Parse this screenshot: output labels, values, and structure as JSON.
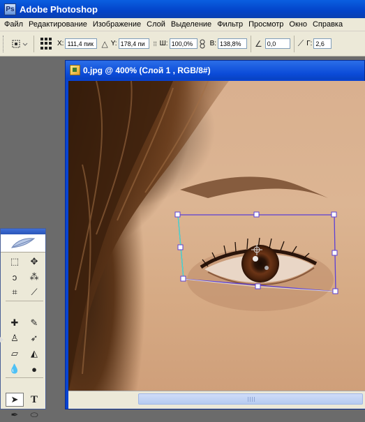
{
  "app": {
    "title": "Adobe Photoshop",
    "logo_text": "Ps"
  },
  "menu": [
    "Файл",
    "Редактирование",
    "Изображение",
    "Слой",
    "Выделение",
    "Фильтр",
    "Просмотр",
    "Окно",
    "Справка"
  ],
  "options": {
    "x_label": "X:",
    "x_value": "111,4 пик",
    "y_label": "Y:",
    "y_value": "178,4 пи",
    "w_label": "Ш:",
    "w_value": "100,0%",
    "h_label": "В:",
    "h_value": "138,8%",
    "angle_value": "0,0",
    "skew_label": "Г:",
    "skew_value": "2,6"
  },
  "document": {
    "title": "0.jpg @ 400% (Слой 1 , RGB/8#)"
  },
  "toolbox": {
    "tools": [
      {
        "name": "marquee-tool",
        "glyph": "⬚"
      },
      {
        "name": "move-tool",
        "glyph": "✥"
      },
      {
        "name": "lasso-tool",
        "glyph": "ↄ"
      },
      {
        "name": "magic-wand-tool",
        "glyph": "⁂"
      },
      {
        "name": "crop-tool",
        "glyph": "⌗"
      },
      {
        "name": "slice-tool",
        "glyph": "⟋"
      },
      {
        "name": "healing-brush-tool",
        "glyph": "✚"
      },
      {
        "name": "brush-tool",
        "glyph": "✎"
      },
      {
        "name": "stamp-tool",
        "glyph": "♙"
      },
      {
        "name": "history-brush-tool",
        "glyph": "➶"
      },
      {
        "name": "eraser-tool",
        "glyph": "▱"
      },
      {
        "name": "bucket-tool",
        "glyph": "◭"
      },
      {
        "name": "blur-tool",
        "glyph": "💧"
      },
      {
        "name": "dodge-tool",
        "glyph": "●"
      },
      {
        "name": "path-select-tool",
        "glyph": "➤"
      },
      {
        "name": "type-tool",
        "glyph": "T"
      },
      {
        "name": "pen-tool",
        "glyph": "✒"
      },
      {
        "name": "shape-tool",
        "glyph": "⬭"
      }
    ]
  },
  "colors": {
    "titlebar": "#0a4fd8",
    "selection": "#5b3fd6",
    "selection_alt": "#40e0d0"
  }
}
